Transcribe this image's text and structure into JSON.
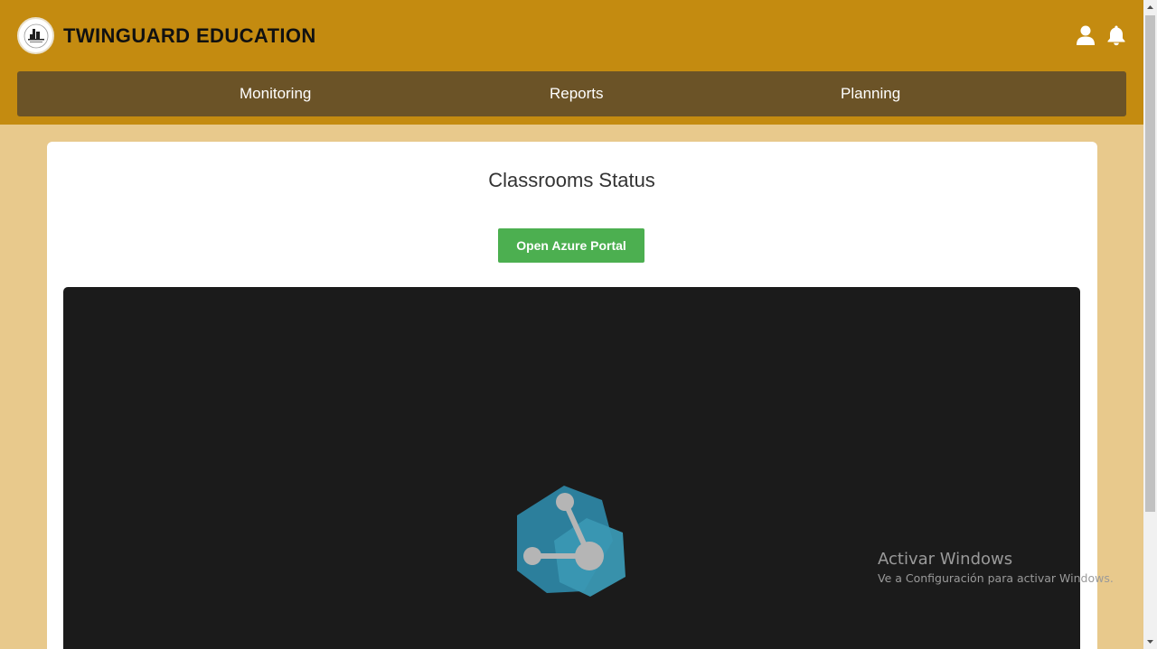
{
  "app": {
    "title": "TWINGUARD EDUCATION"
  },
  "header": {
    "logo_icon": "school-building-logo",
    "user_icon": "user-icon",
    "bell_icon": "bell-icon"
  },
  "nav": {
    "items": [
      {
        "label": "Monitoring"
      },
      {
        "label": "Reports"
      },
      {
        "label": "Planning"
      }
    ]
  },
  "main": {
    "title": "Classrooms Status",
    "azure_button": "Open Azure Portal",
    "viewer_icon": "azure-digital-twins-icon"
  },
  "watermark": {
    "title": "Activar Windows",
    "subtitle": "Ve a Configuración para activar Windows."
  },
  "colors": {
    "header": "#c48b10",
    "navbar": "#6b5327",
    "page_background": "#e8c98c",
    "button": "#4caf50",
    "viewer": "#1b1b1b"
  }
}
